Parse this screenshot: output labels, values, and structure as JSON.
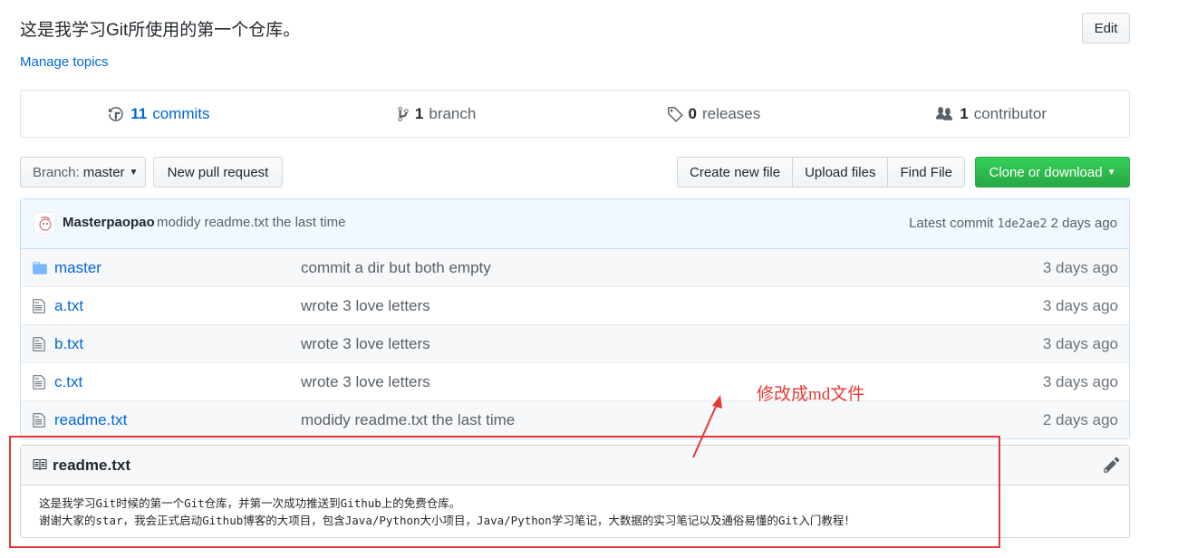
{
  "repo": {
    "description": "这是我学习Git所使用的第一个仓库。",
    "manage_topics": "Manage topics",
    "edit_label": "Edit"
  },
  "summary": {
    "commits_count": "11",
    "commits_label": "commits",
    "branches_count": "1",
    "branches_label": "branch",
    "releases_count": "0",
    "releases_label": "releases",
    "contributors_count": "1",
    "contributors_label": "contributor"
  },
  "toolbar": {
    "branch_prefix": "Branch:",
    "branch_name": "master",
    "new_pull_request": "New pull request",
    "create_new_file": "Create new file",
    "upload_files": "Upload files",
    "find_file": "Find File",
    "clone_or_download": "Clone or download"
  },
  "latest_commit": {
    "author": "Masterpaopao",
    "message": "modidy readme.txt the last time",
    "latest_label": "Latest commit",
    "sha": "1de2ae2",
    "age": "2 days ago"
  },
  "files": [
    {
      "name": "master",
      "type": "folder",
      "message": "commit a dir but both empty",
      "age": "3 days ago"
    },
    {
      "name": "a.txt",
      "type": "file",
      "message": "wrote 3 love letters",
      "age": "3 days ago"
    },
    {
      "name": "b.txt",
      "type": "file",
      "message": "wrote 3 love letters",
      "age": "3 days ago"
    },
    {
      "name": "c.txt",
      "type": "file",
      "message": "wrote 3 love letters",
      "age": "3 days ago"
    },
    {
      "name": "readme.txt",
      "type": "file",
      "message": "modidy readme.txt the last time",
      "age": "2 days ago"
    }
  ],
  "readme": {
    "title": "readme.txt",
    "line1": "这是我学习Git时候的第一个Git仓库，并第一次成功推送到Github上的免费仓库。",
    "line2": "谢谢大家的star，我会正式启动Github博客的大项目，包含Java/Python大小项目，Java/Python学习笔记，大数据的实习笔记以及通俗易懂的Git入门教程！"
  },
  "annotation": {
    "text": "修改成md文件",
    "color": "#e53935"
  },
  "colors": {
    "link": "#0366d6",
    "green": "#28a745",
    "commit_bar": "#f1f8ff"
  }
}
